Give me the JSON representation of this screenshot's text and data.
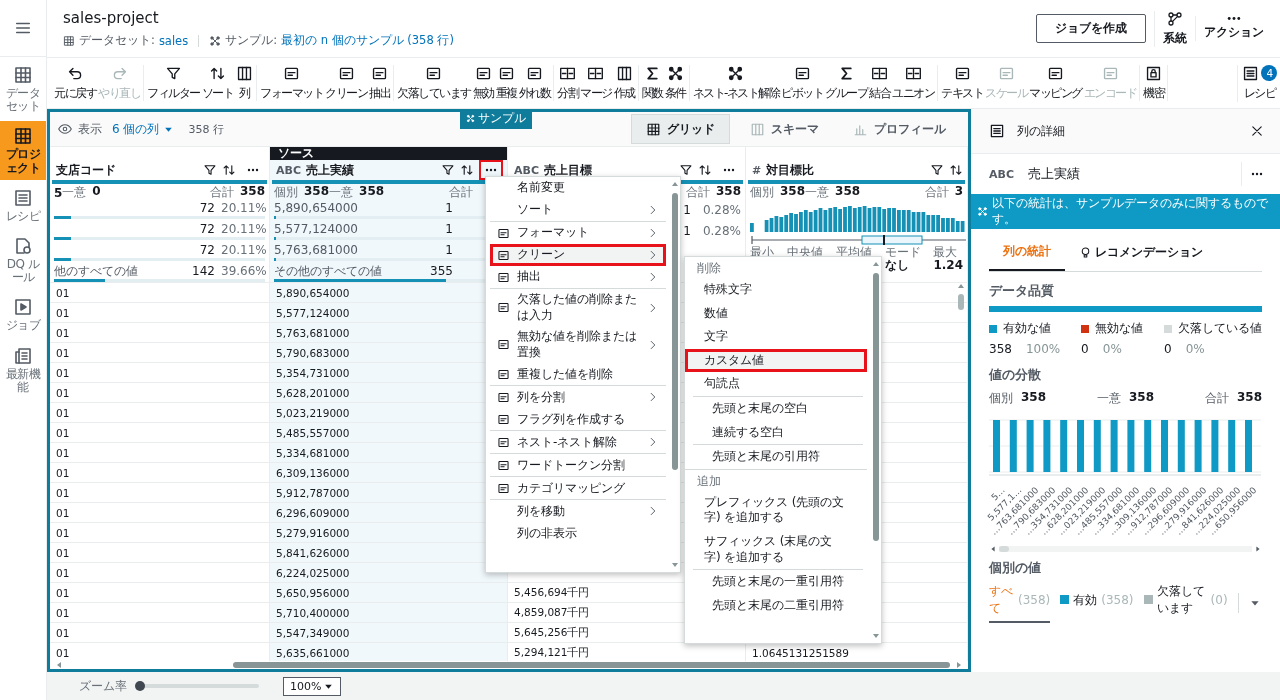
{
  "rail": {
    "items": [
      {
        "label": "データセット",
        "selected": false
      },
      {
        "label": "プロジェクト",
        "selected": true
      },
      {
        "label": "レシピ",
        "selected": false
      },
      {
        "label": "DQ ルール",
        "selected": false
      },
      {
        "label": "ジョブ",
        "selected": false
      },
      {
        "label": "最新機能",
        "selected": false
      }
    ]
  },
  "header": {
    "title": "sales-project",
    "dataset_label": "データセット:",
    "dataset_link": "sales",
    "sample_label": "サンプル:",
    "sample_link": "最初の n 個のサンプル (358 行)",
    "create_job": "ジョブを作成",
    "actions": [
      "系統",
      "アクション"
    ]
  },
  "toolbar": {
    "groups": [
      [
        {
          "label": "元に戻す",
          "disabled": false
        },
        {
          "label": "やり直し",
          "disabled": true
        }
      ],
      [
        {
          "label": "フィルター",
          "disabled": false
        },
        {
          "label": "ソート",
          "disabled": false
        },
        {
          "label": "列",
          "disabled": false
        }
      ],
      [
        {
          "label": "フォーマット",
          "disabled": false
        },
        {
          "label": "クリーン",
          "disabled": false
        },
        {
          "label": "抽出",
          "disabled": false
        }
      ],
      [
        {
          "label": "欠落しています",
          "disabled": false
        },
        {
          "label": "無効",
          "disabled": false
        },
        {
          "label": "重複",
          "disabled": false
        },
        {
          "label": "外れ数",
          "disabled": false
        }
      ],
      [
        {
          "label": "分割",
          "disabled": false
        },
        {
          "label": "マージ",
          "disabled": false
        },
        {
          "label": "作成",
          "disabled": false
        }
      ],
      [
        {
          "label": "関数",
          "disabled": false
        },
        {
          "label": "条件",
          "disabled": false
        }
      ],
      [
        {
          "label": "ネスト-ネスト解除",
          "disabled": false
        },
        {
          "label": "ピボット",
          "disabled": false
        },
        {
          "label": "グループ",
          "disabled": false
        },
        {
          "label": "結合",
          "disabled": false
        },
        {
          "label": "ユニオン",
          "disabled": false
        }
      ],
      [
        {
          "label": "テキスト",
          "disabled": false
        },
        {
          "label": "スケール",
          "disabled": true
        },
        {
          "label": "マッピング",
          "disabled": false
        },
        {
          "label": "エンコード",
          "disabled": true
        }
      ],
      [
        {
          "label": "機密",
          "disabled": false
        }
      ]
    ],
    "recipe": {
      "label": "レシピ",
      "badge": "4"
    }
  },
  "grid": {
    "sample_tag": "サンプル",
    "view_label": "表示",
    "columns_picker": "6 個の列",
    "row_count": "358 行",
    "views": [
      {
        "label": "グリッド",
        "selected": true
      },
      {
        "label": "スキーマ",
        "selected": false
      },
      {
        "label": "プロフィール",
        "selected": false
      }
    ],
    "columns": [
      {
        "name": "支店コード",
        "selected": false,
        "menu_button": true,
        "marked": false,
        "stats": {
          "kind": "top_values",
          "totals": [
            {
              "value": "5"
            },
            {
              "label": "一意",
              "value": "0"
            },
            {
              "label": "合計",
              "value": "358"
            }
          ],
          "rows": [
            {
              "count": "72",
              "pct": "20.11%",
              "level": 0.08
            },
            {
              "count": "72",
              "pct": "20.11%",
              "level": 0.08
            },
            {
              "count": "72",
              "pct": "20.11%",
              "level": 0.08
            },
            {
              "label": "他のすべての値",
              "count": "142",
              "pct": "39.66%",
              "level": 0.24
            }
          ]
        }
      },
      {
        "type": "ABC",
        "name": "売上実績",
        "source": "ソース",
        "selected": true,
        "menu_button": true,
        "marked": true,
        "stats": {
          "kind": "top_values",
          "totals": [
            {
              "label": "個別",
              "value": "358"
            },
            {
              "label": "一意",
              "value": "358"
            },
            {
              "label": "合計"
            }
          ],
          "rows": [
            {
              "label": "5,890,654000",
              "count": "1",
              "level": 0.01
            },
            {
              "label": "5,577,124000",
              "count": "1",
              "level": 0.01
            },
            {
              "label": "5,763,681000",
              "count": "1",
              "level": 0.01
            },
            {
              "label": "その他のすべての値",
              "count": "355",
              "level": 0.75
            }
          ]
        }
      },
      {
        "type": "ABC",
        "name": "売上目標",
        "selected": false,
        "menu_button": true,
        "marked": false,
        "stats": {
          "kind": "top_values",
          "totals": [
            {
              "label": "合計",
              "value": "358"
            }
          ],
          "rows": [
            {
              "count": "1",
              "pct": "0.28%"
            },
            {
              "count": "1",
              "pct": "0.28%"
            }
          ]
        }
      },
      {
        "type": "#",
        "name": "対目標比",
        "selected": false,
        "menu_button": false,
        "stats": {
          "kind": "numeric",
          "totals": [
            {
              "label": "個別",
              "value": "358"
            },
            {
              "label": "一意",
              "value": "358"
            },
            {
              "label": "合計",
              "value": "3"
            }
          ],
          "summary": [
            {
              "label": "最小"
            },
            {
              "label": "中央値"
            },
            {
              "label": "平均値"
            },
            {
              "label": "モード",
              "value": "なし"
            },
            {
              "label": "最大",
              "value": "1.24"
            }
          ]
        }
      }
    ],
    "rows": [
      {
        "cells": [
          "01",
          "5,890,654000"
        ]
      },
      {
        "cells": [
          "01",
          "5,577,124000"
        ]
      },
      {
        "cells": [
          "01",
          "5,763,681000"
        ]
      },
      {
        "cells": [
          "01",
          "5,790,683000"
        ]
      },
      {
        "cells": [
          "01",
          "5,354,731000"
        ]
      },
      {
        "cells": [
          "01",
          "5,628,201000"
        ]
      },
      {
        "cells": [
          "01",
          "5,023,219000"
        ]
      },
      {
        "cells": [
          "01",
          "5,485,557000"
        ]
      },
      {
        "cells": [
          "01",
          "5,334,681000"
        ]
      },
      {
        "cells": [
          "01",
          "6,309,136000"
        ]
      },
      {
        "cells": [
          "01",
          "5,912,787000"
        ]
      },
      {
        "cells": [
          "01",
          "6,296,609000"
        ]
      },
      {
        "cells": [
          "01",
          "5,279,916000"
        ]
      },
      {
        "cells": [
          "01",
          "5,841,626000"
        ]
      },
      {
        "cells": [
          "01",
          "6,224,025000"
        ]
      },
      {
        "cells": [
          "01",
          "5,650,956000",
          "5,456,694千円"
        ]
      },
      {
        "cells": [
          "01",
          "5,710,400000",
          "4,859,087千円"
        ]
      },
      {
        "cells": [
          "01",
          "5,547,349000",
          "5,645,256千円"
        ]
      },
      {
        "cells": [
          "01",
          "5,635,661000",
          "5,294,121千円",
          "1.0645131251589"
        ]
      }
    ]
  },
  "menu": {
    "groups": [
      [
        {
          "label": "名前変更",
          "icon": false,
          "submenu": false,
          "selected": false,
          "marked": false
        },
        {
          "label": "ソート",
          "icon": false,
          "submenu": true,
          "selected": false,
          "marked": false
        }
      ],
      [
        {
          "label": "フォーマット",
          "icon": true,
          "submenu": true,
          "selected": false,
          "marked": false
        },
        {
          "label": "クリーン",
          "icon": true,
          "submenu": true,
          "selected": true,
          "marked": true
        },
        {
          "label": "抽出",
          "icon": true,
          "submenu": true,
          "selected": false,
          "marked": false
        }
      ],
      [
        {
          "label": "欠落した値の削除または入力",
          "icon": true,
          "submenu": true,
          "selected": false,
          "marked": false
        },
        {
          "label": "無効な値を削除または置換",
          "icon": true,
          "submenu": true,
          "selected": false,
          "marked": false
        },
        {
          "label": "重複した値を削除",
          "icon": true,
          "submenu": false,
          "selected": false,
          "marked": false
        }
      ],
      [
        {
          "label": "列を分割",
          "icon": true,
          "submenu": true,
          "selected": false,
          "marked": false
        },
        {
          "label": "フラグ列を作成する",
          "icon": true,
          "submenu": false,
          "selected": false,
          "marked": false
        }
      ],
      [
        {
          "label": "ネスト-ネスト解除",
          "icon": true,
          "submenu": true,
          "selected": false,
          "marked": false
        }
      ],
      [
        {
          "label": "ワードトークン分割",
          "icon": true,
          "submenu": false,
          "selected": false,
          "marked": false
        }
      ],
      [
        {
          "label": "カテゴリマッピング",
          "icon": true,
          "submenu": false,
          "selected": false,
          "marked": false
        }
      ],
      [
        {
          "label": "列を移動",
          "icon": false,
          "submenu": true,
          "selected": false,
          "marked": false
        },
        {
          "label": "列の非表示",
          "icon": false,
          "submenu": false,
          "selected": false,
          "marked": false
        }
      ]
    ]
  },
  "submenu": {
    "sections": [
      {
        "header": "削除",
        "groups": [
          [
            {
              "label": "特殊文字",
              "selected": false,
              "marked": false
            },
            {
              "label": "数値",
              "selected": false,
              "marked": false
            },
            {
              "label": "文字",
              "selected": false,
              "marked": false
            },
            {
              "label": "カスタム値",
              "selected": true,
              "marked": true
            },
            {
              "label": "句読点",
              "selected": false,
              "marked": false
            }
          ],
          [
            {
              "label": "先頭と末尾の空白",
              "selected": false,
              "marked": false
            },
            {
              "label": "連続する空白",
              "selected": false,
              "marked": false
            }
          ],
          [
            {
              "label": "先頭と末尾の引用符",
              "selected": false,
              "marked": false
            }
          ]
        ]
      },
      {
        "header": "追加",
        "groups": [
          [
            {
              "label": "プレフィックス (先頭の文字) を追加する",
              "selected": false,
              "marked": false
            },
            {
              "label": "サフィックス (末尾の文字) を追加する",
              "selected": false,
              "marked": false
            }
          ],
          [
            {
              "label": "先頭と末尾の一重引用符",
              "selected": false,
              "marked": false
            },
            {
              "label": "先頭と末尾の二重引用符",
              "selected": false,
              "marked": false
            }
          ]
        ]
      }
    ]
  },
  "side": {
    "title": "列の詳細",
    "column_type": "ABC",
    "column_name": "売上実績",
    "banner": "以下の統計は、サンプルデータのみに関するものです。",
    "tabs": [
      {
        "label": "列の統計",
        "selected": true
      },
      {
        "label": "レコメンデーション",
        "selected": false
      }
    ],
    "quality": {
      "title": "データ品質",
      "items": [
        {
          "label": "有効な値",
          "count": "358",
          "pct": "100%",
          "color": "#0e9ac4",
          "level": 1
        },
        {
          "label": "無効な値",
          "count": "0",
          "pct": "0%",
          "color": "#d13212",
          "level": 0
        },
        {
          "label": "欠落している値",
          "count": "0",
          "pct": "0%",
          "color": "#d5dbdb",
          "level": 0
        }
      ]
    },
    "distribution": {
      "title": "値の分散",
      "counts": [
        {
          "label": "個別",
          "value": "358"
        },
        {
          "label": "一意",
          "value": "358"
        },
        {
          "label": "合計",
          "value": "358"
        }
      ],
      "labels": [
        "5…",
        "5,577,1…",
        "…763,681000",
        "…790,683000",
        "…354,731000",
        "…628,201000",
        "…023,219000",
        "…485,557000",
        "…334,681000",
        "…309,136000",
        "…912,787000",
        "…296,609000",
        "…279,916000",
        "…841,626000",
        "…224,025000",
        "…650,956000"
      ]
    },
    "distinct": {
      "title": "個別の値",
      "filters": [
        {
          "label": "すべて",
          "count": "(358)",
          "selected": true
        },
        {
          "label": "有効",
          "count": "(358)",
          "color": "#0e9ac4",
          "selected": false
        },
        {
          "label": "欠落しています",
          "count": "(0)",
          "color": "#aab7b8",
          "selected": false
        }
      ]
    }
  },
  "zoom": {
    "label": "ズーム率",
    "level": 0,
    "value": "100%"
  }
}
